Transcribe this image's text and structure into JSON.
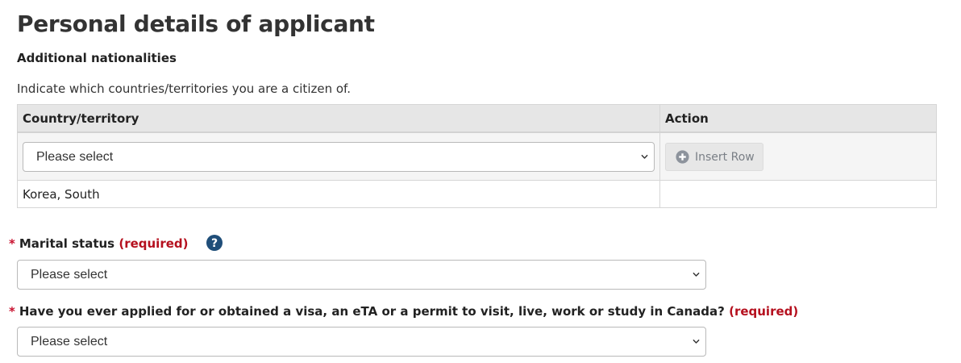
{
  "page": {
    "title": "Personal details of applicant"
  },
  "nationalities": {
    "heading": "Additional nationalities",
    "instruction": "Indicate which countries/territories you are a citizen of.",
    "columns": [
      "Country/territory",
      "Action"
    ],
    "country_select": {
      "value": "Please select"
    },
    "insert_button": {
      "label": "Insert Row",
      "icon": "plus-circle-icon"
    },
    "rows": [
      {
        "country": "Korea, South",
        "action": ""
      }
    ]
  },
  "marital_status": {
    "star": "*",
    "label": "Marital status",
    "required": "(required)",
    "help_icon": "question-circle-icon",
    "select_value": "Please select"
  },
  "previous_application": {
    "star": "*",
    "label": "Have you ever applied for or obtained a visa, an eTA or a permit to visit, live, work or study in Canada?",
    "required": "(required)",
    "select_value": "Please select"
  },
  "colors": {
    "required": "#b5101e",
    "header_bg": "#e6e6e6",
    "help_icon": "#1f4e79"
  }
}
